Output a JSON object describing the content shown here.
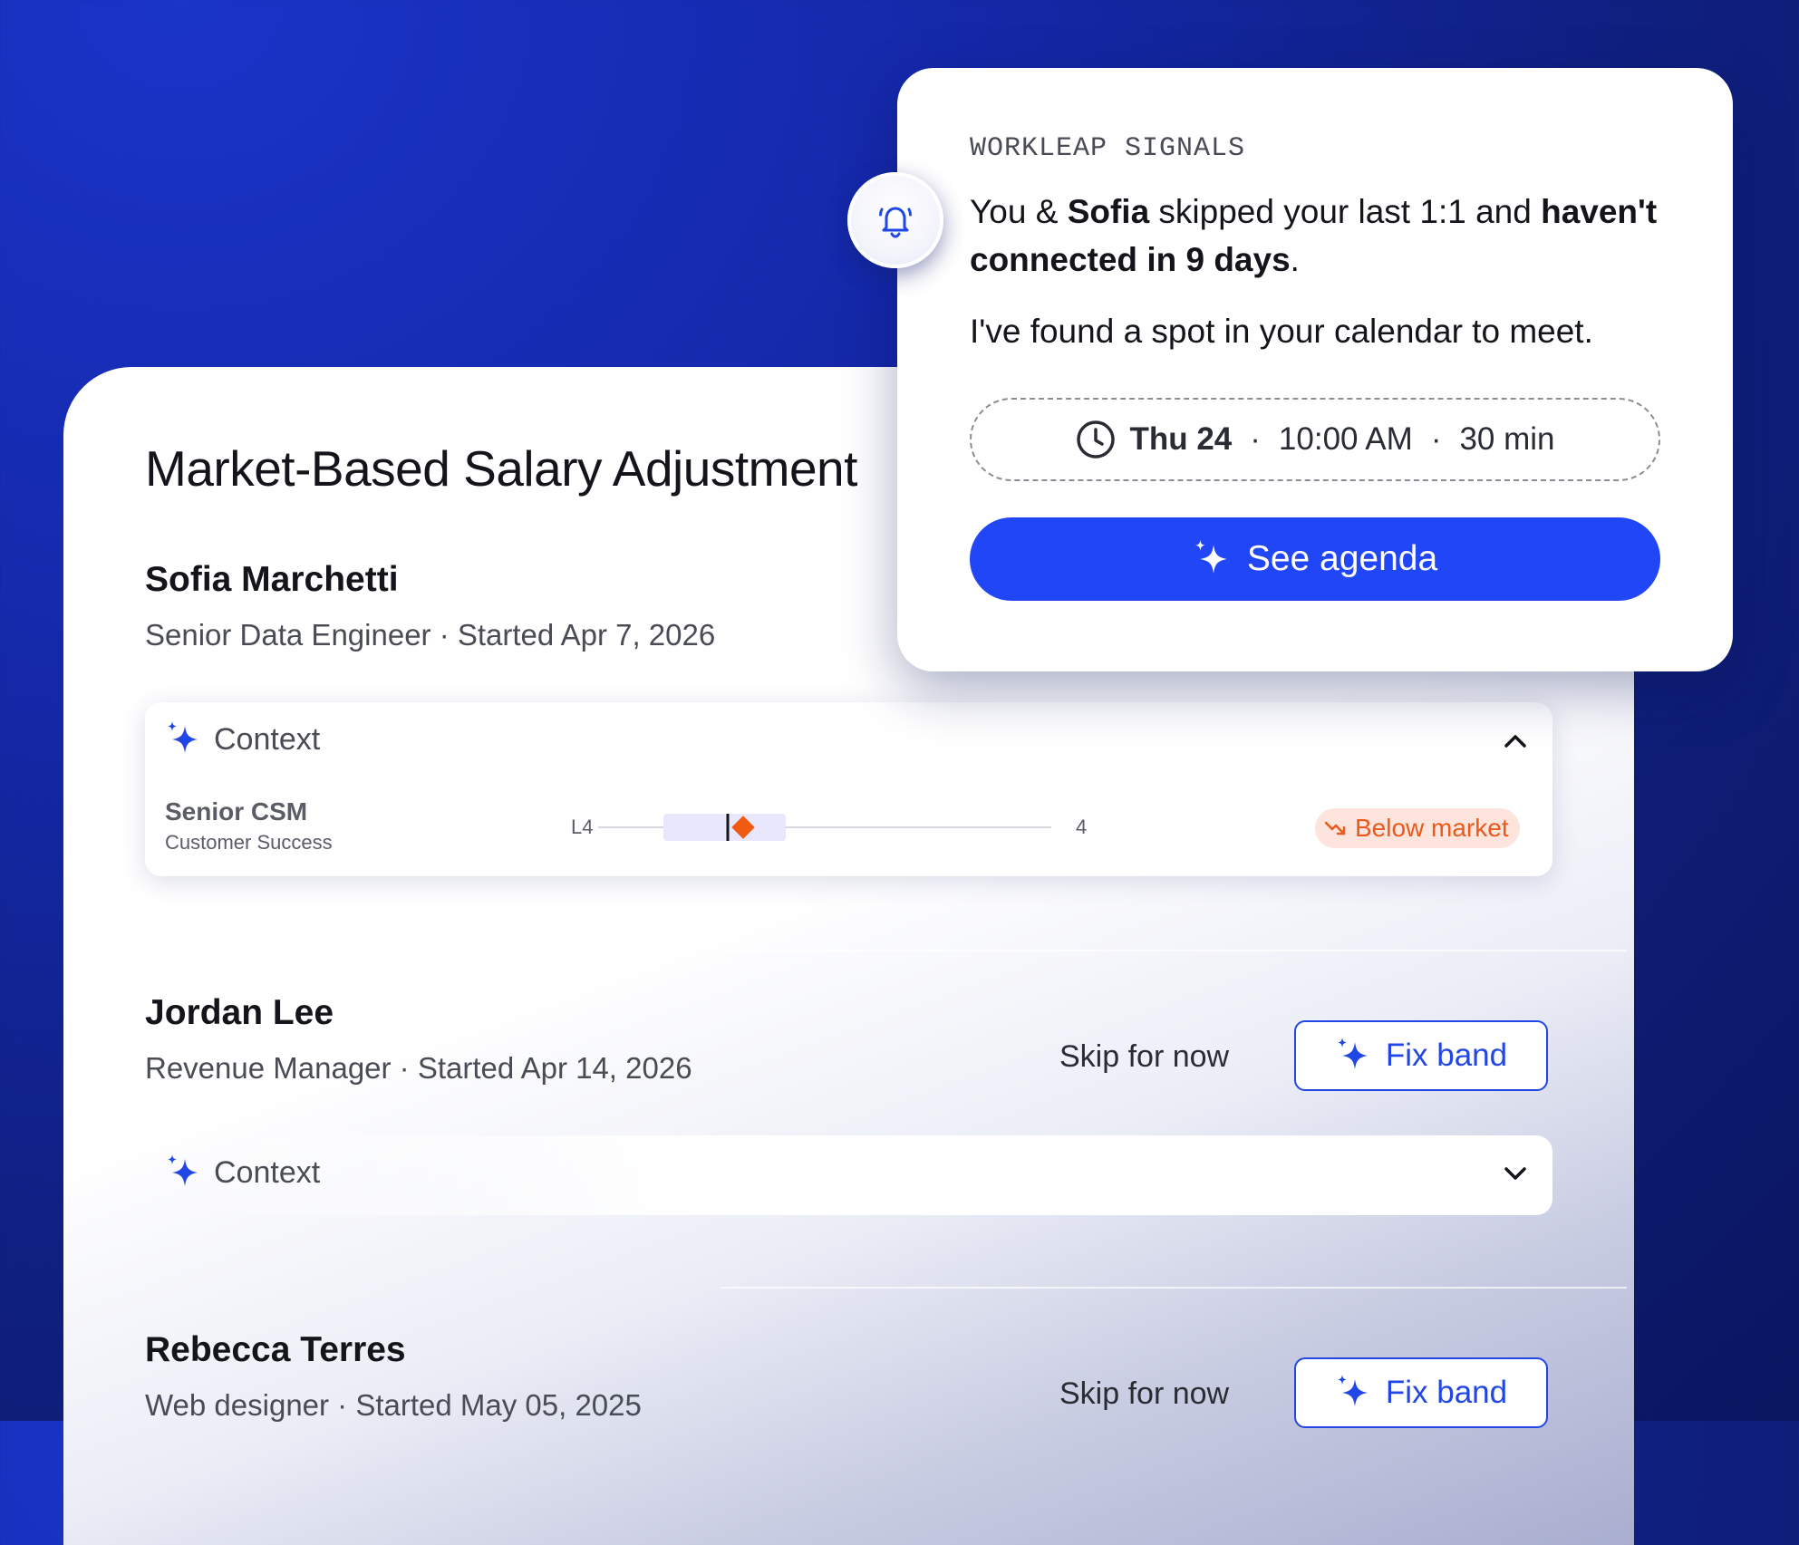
{
  "page_title": "Market-Based Salary Adjustment",
  "employees": [
    {
      "name": "Sofia Marchetti",
      "subtitle": "Senior Data Engineer · Started Apr 7, 2026",
      "context": {
        "label": "Context",
        "expanded": true,
        "role": "Senior CSM",
        "department": "Customer Success",
        "band_low": "L4",
        "band_high": "4",
        "status": "Below market",
        "status_color": "#ea5a1b"
      }
    },
    {
      "name": "Jordan Lee",
      "subtitle": "Revenue Manager · Started Apr 14, 2026",
      "skip_label": "Skip for now",
      "fix_label": "Fix band",
      "context": {
        "label": "Context",
        "expanded": false
      }
    },
    {
      "name": "Rebecca Terres",
      "subtitle": "Web designer · Started May 05, 2025",
      "skip_label": "Skip for now",
      "fix_label": "Fix band"
    }
  ],
  "signal": {
    "eyebrow": "WORKLEAP SIGNALS",
    "msg_prefix": "You & ",
    "msg_name": "Sofia",
    "msg_mid": " skipped your last 1:1 and ",
    "msg_bold": "haven't connected in 9 days",
    "msg_end": ".",
    "msg2": "I've found a spot in your calendar to meet.",
    "slot_day": "Thu 24",
    "slot_sep": "·",
    "slot_time": "10:00 AM",
    "slot_duration": "30 min",
    "cta_label": "See agenda",
    "accent_color": "#2146f5"
  }
}
